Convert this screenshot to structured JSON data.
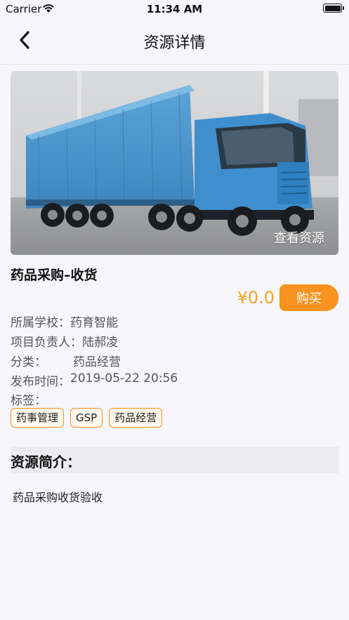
{
  "status": {
    "carrier": "Carrier",
    "time": "11:34 AM"
  },
  "nav": {
    "title": "资源详情"
  },
  "cover": {
    "overlay_label": "查看资源"
  },
  "resource": {
    "title": "药品采购–收货",
    "price": "¥0.0",
    "buy_label": "购买"
  },
  "info": [
    {
      "label": "所属学校：",
      "value": "药育智能"
    },
    {
      "label": "项目负责人：",
      "value": "陆郝凌"
    },
    {
      "label_a": "分",
      "label_b": "类：",
      "value": "药品经营"
    },
    {
      "label": "发布时间：",
      "value": "2019-05-22 20:56"
    },
    {
      "label_a": "标",
      "label_b": "签：",
      "value": ""
    }
  ],
  "tags": [
    "药事管理",
    "GSP",
    "药品经营"
  ],
  "intro": {
    "heading": "资源简介：",
    "text": "药品采购收货验收"
  },
  "colors": {
    "accent": "#f7931e",
    "price": "#f5a623",
    "background": "#f6f6fb"
  },
  "icons": {
    "back": "chevron-left-icon",
    "wifi": "wifi-icon",
    "battery": "battery-icon"
  }
}
